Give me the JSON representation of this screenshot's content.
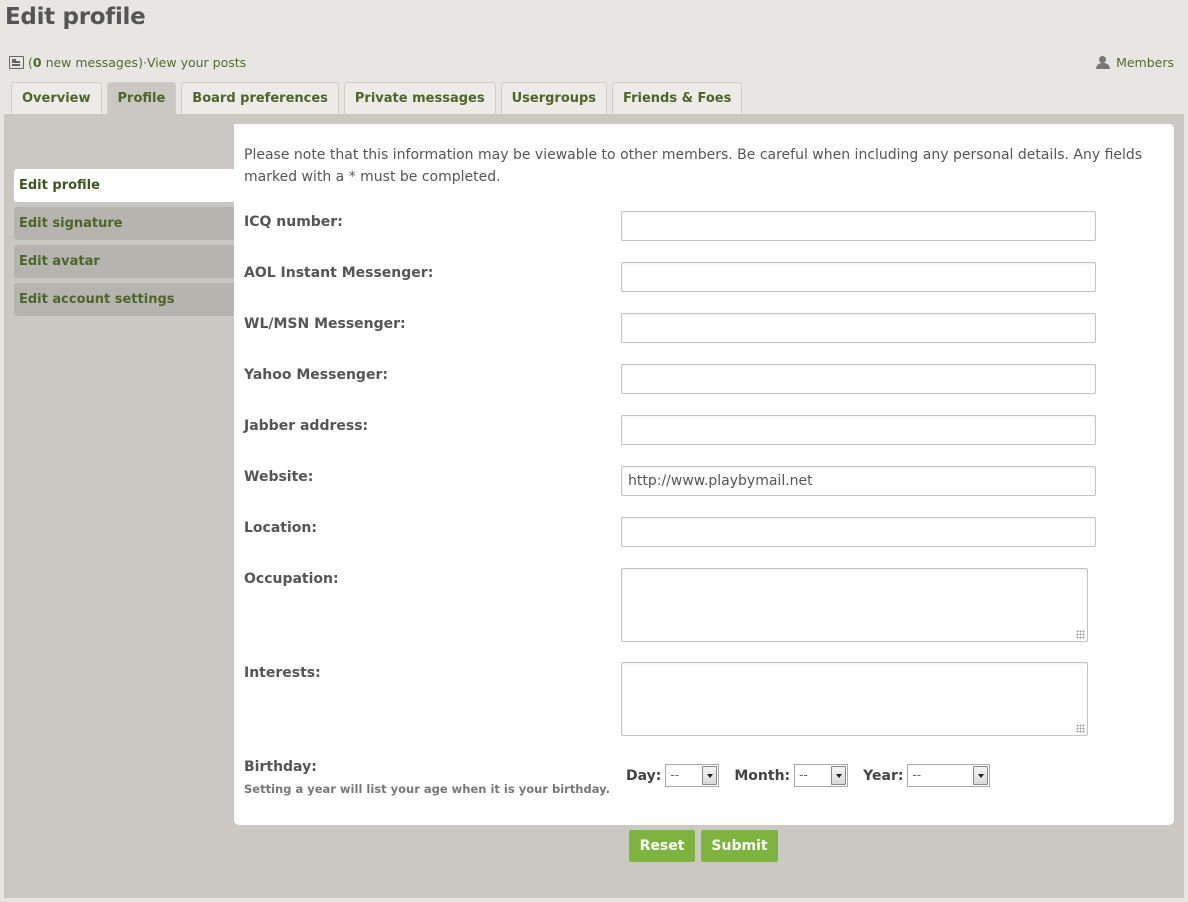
{
  "header": {
    "title": "Edit profile"
  },
  "messages": {
    "open_paren": "(",
    "count": "0",
    "text": " new messages)",
    "separator": " · ",
    "view_posts": "View your posts"
  },
  "members_link": "Members",
  "tabs": [
    {
      "label": "Overview",
      "active": false
    },
    {
      "label": "Profile",
      "active": true
    },
    {
      "label": "Board preferences",
      "active": false
    },
    {
      "label": "Private messages",
      "active": false
    },
    {
      "label": "Usergroups",
      "active": false
    },
    {
      "label": "Friends & Foes",
      "active": false
    }
  ],
  "sidenav": [
    {
      "label": "Edit profile",
      "active": true
    },
    {
      "label": "Edit signature",
      "active": false
    },
    {
      "label": "Edit avatar",
      "active": false
    },
    {
      "label": "Edit account settings",
      "active": false
    }
  ],
  "form": {
    "notice": "Please note that this information may be viewable to other members. Be careful when including any personal details. Any fields marked with a * must be completed.",
    "fields": [
      {
        "label": "ICQ number:",
        "value": ""
      },
      {
        "label": "AOL Instant Messenger:",
        "value": ""
      },
      {
        "label": "WL/MSN Messenger:",
        "value": ""
      },
      {
        "label": "Yahoo Messenger:",
        "value": ""
      },
      {
        "label": "Jabber address:",
        "value": ""
      },
      {
        "label": "Website:",
        "value": "http://www.playbymail.net"
      },
      {
        "label": "Location:",
        "value": ""
      }
    ],
    "occupation_label": "Occupation:",
    "interests_label": "Interests:",
    "birthday": {
      "label": "Birthday:",
      "hint": "Setting a year will list your age when it is your birthday.",
      "day_label": "Day:",
      "day_value": "--",
      "month_label": "Month:",
      "month_value": "--",
      "year_label": "Year:",
      "year_value": "--"
    }
  },
  "buttons": {
    "reset": "Reset",
    "submit": "Submit"
  }
}
